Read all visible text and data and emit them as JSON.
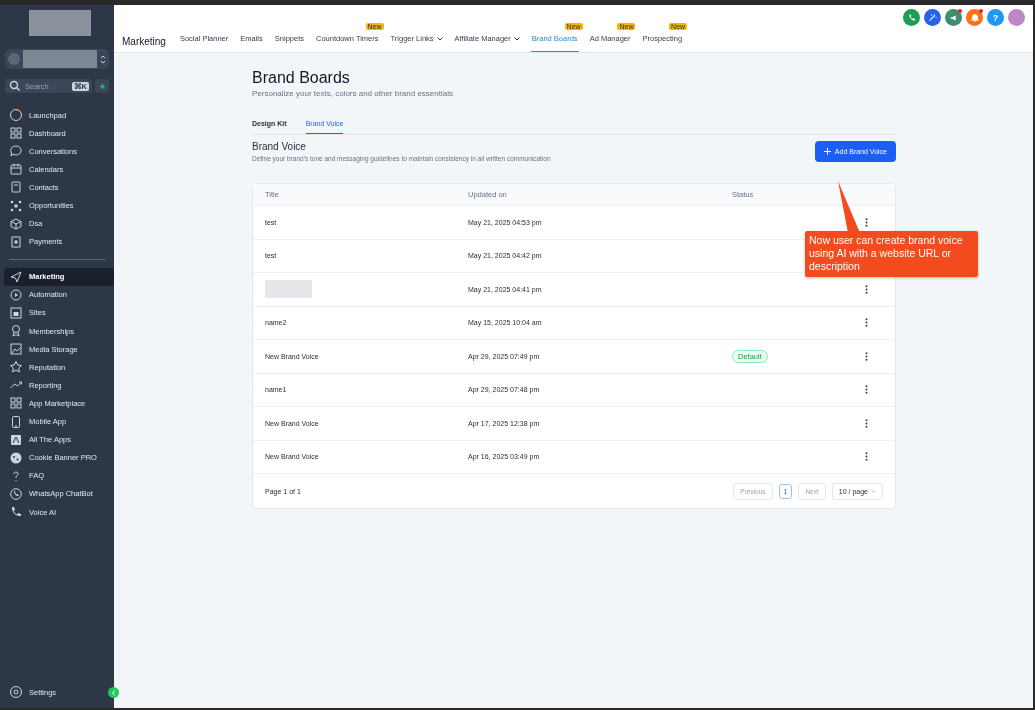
{
  "sidebar": {
    "search": {
      "placeholder": "Search",
      "shortcut": "⌘K"
    },
    "items": [
      {
        "label": "Launchpad",
        "selected": false
      },
      {
        "label": "Dashboard",
        "selected": false
      },
      {
        "label": "Conversations",
        "selected": false
      },
      {
        "label": "Calendars",
        "selected": false
      },
      {
        "label": "Contacts",
        "selected": false
      },
      {
        "label": "Opportunities",
        "selected": false
      },
      {
        "label": "Dsa",
        "selected": false
      },
      {
        "label": "Payments",
        "selected": false
      }
    ],
    "items_2": [
      {
        "label": "Marketing",
        "selected": true
      },
      {
        "label": "Automation",
        "selected": false
      },
      {
        "label": "Sites",
        "selected": false
      },
      {
        "label": "Memberships",
        "selected": false
      },
      {
        "label": "Media Storage",
        "selected": false
      },
      {
        "label": "Reputation",
        "selected": false
      },
      {
        "label": "Reporting",
        "selected": false
      },
      {
        "label": "App Marketplace",
        "selected": false
      },
      {
        "label": "Mobile App",
        "selected": false
      },
      {
        "label": "All The Apps",
        "selected": false
      },
      {
        "label": "Cookie Banner PRO",
        "selected": false
      },
      {
        "label": "FAQ",
        "selected": false
      },
      {
        "label": "WhatsApp ChatBot",
        "selected": false
      },
      {
        "label": "Voice AI",
        "selected": false
      }
    ],
    "settings": "Settings"
  },
  "top_nav": {
    "title": "Marketing",
    "tabs": [
      {
        "label": "Social Planner",
        "selected": false,
        "dropdown": false
      },
      {
        "label": "Emails",
        "selected": false,
        "dropdown": false
      },
      {
        "label": "Snippets",
        "selected": false,
        "dropdown": false
      },
      {
        "label": "Countdown Timers",
        "selected": false,
        "dropdown": false,
        "badge": "New"
      },
      {
        "label": "Trigger Links",
        "selected": false,
        "dropdown": true
      },
      {
        "label": "Affiliate Manager",
        "selected": false,
        "dropdown": true
      },
      {
        "label": "Brand Boards",
        "selected": true,
        "dropdown": false,
        "badge": "New"
      },
      {
        "label": "Ad Manager",
        "selected": false,
        "dropdown": false,
        "badge": "New"
      },
      {
        "label": "Prospecting",
        "selected": false,
        "dropdown": false,
        "badge": "New"
      }
    ],
    "actions": [
      {
        "kind": "phone",
        "color": "#1f9d55",
        "dot": false
      },
      {
        "kind": "magic",
        "color": "#2563eb",
        "dot": false
      },
      {
        "kind": "megaphone",
        "color": "#3f8f6f",
        "dot": true
      },
      {
        "kind": "bell",
        "color": "#f97316",
        "dot": true
      },
      {
        "kind": "help",
        "color": "#2196f3",
        "dot": false,
        "label": "?"
      },
      {
        "kind": "avatar",
        "color": "#c084c8",
        "dot": false
      }
    ]
  },
  "page": {
    "title": "Brand Boards",
    "subtitle": "Personalize your texts, colors and other brand essentials",
    "tabs": [
      {
        "label": "Design Kit",
        "selected": false
      },
      {
        "label": "Brand Voice",
        "selected": true
      }
    ],
    "section_title": "Brand Voice",
    "section_description": "Define your brand's tone and messaging guidelines to maintain consistency in all written communication",
    "add_button": "Add Brand Voice",
    "table": {
      "columns": [
        "Title",
        "Updated on",
        "Status"
      ],
      "rows": [
        {
          "title": "test",
          "updated": "May 21, 2025 04:53 pm",
          "redacted": false
        },
        {
          "title": "test",
          "updated": "May 21, 2025 04:42 pm",
          "redacted": false
        },
        {
          "updated": "May 21, 2025 04:41 pm",
          "redacted": true
        },
        {
          "title": "name2",
          "updated": "May 15, 2025 10:04 am",
          "redacted": false
        },
        {
          "title": "New Brand Voice",
          "updated": "Apr 29, 2025 07:49 pm",
          "status": "Default",
          "redacted": false
        },
        {
          "title": "name1",
          "updated": "Apr 29, 2025 07:48 pm",
          "redacted": false
        },
        {
          "title": "New Brand Voice",
          "updated": "Apr 17, 2025 12:38 pm",
          "redacted": false
        },
        {
          "title": "New Brand Voice",
          "updated": "Apr 16, 2025 03:49 pm",
          "redacted": false
        }
      ]
    },
    "pagination": {
      "summary": "Page 1 of 1",
      "previous": "Previous",
      "pages": [
        {
          "label": "1",
          "selected": true
        }
      ],
      "next": "Next",
      "page_size": "10 / page"
    }
  },
  "callout": {
    "text": "Now user can create brand voice using AI with a website URL or description"
  }
}
